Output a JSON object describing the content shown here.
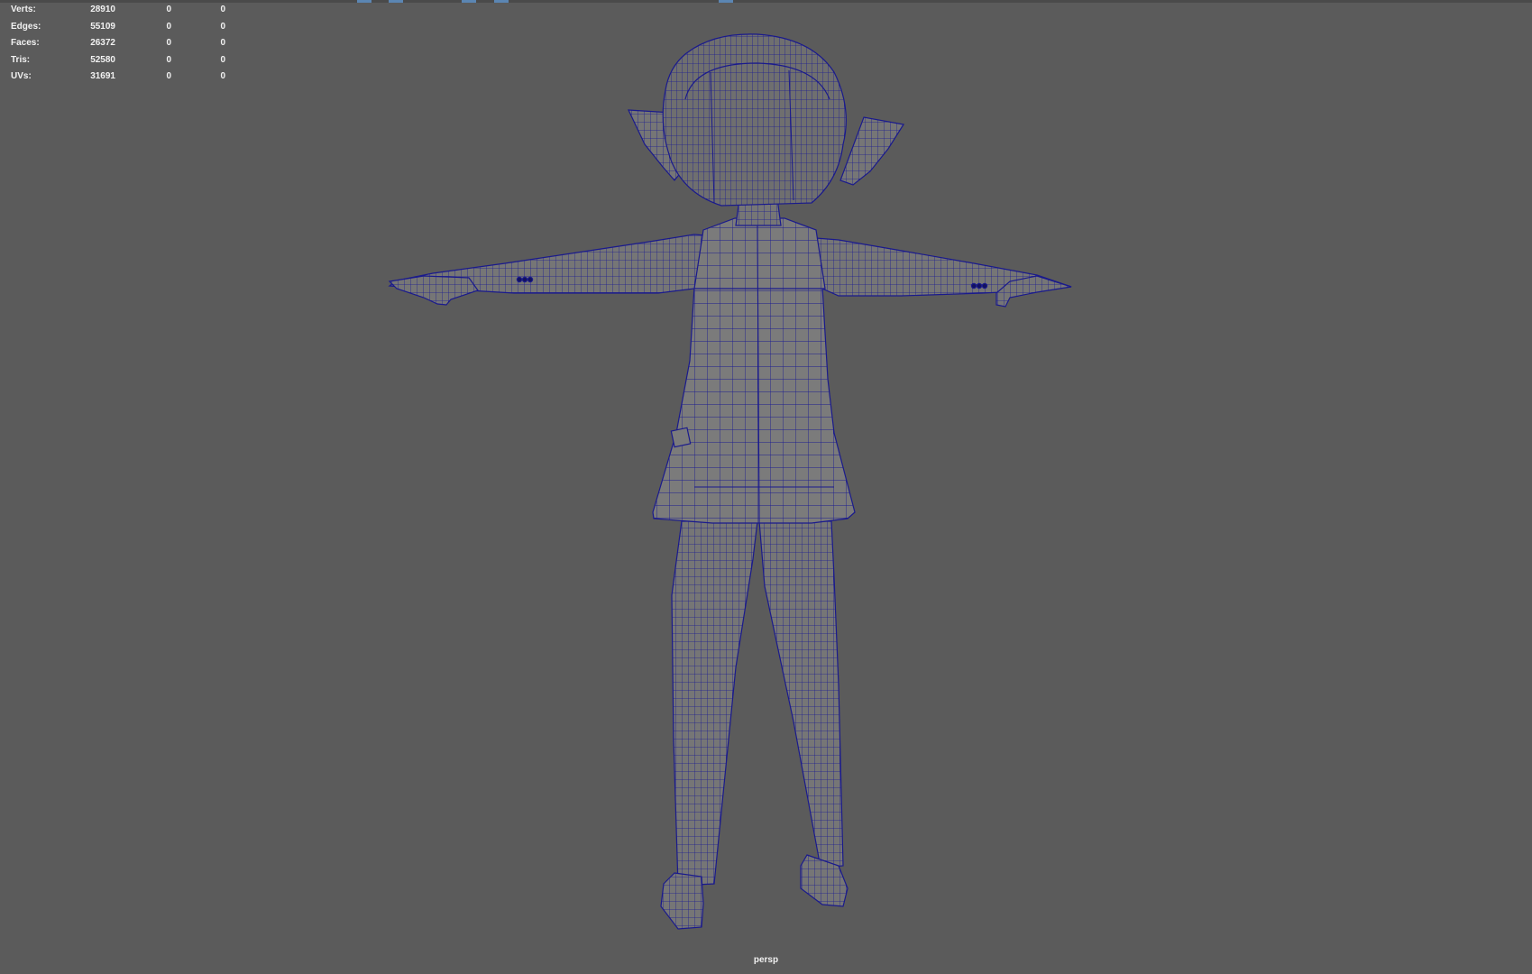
{
  "hud": {
    "rows": [
      {
        "label": "Verts:",
        "total": "28910",
        "selected": "0",
        "component": "0"
      },
      {
        "label": "Edges:",
        "total": "55109",
        "selected": "0",
        "component": "0"
      },
      {
        "label": "Faces:",
        "total": "26372",
        "selected": "0",
        "component": "0"
      },
      {
        "label": "Tris:",
        "total": "52580",
        "selected": "0",
        "component": "0"
      },
      {
        "label": "UVs:",
        "total": "31691",
        "selected": "0",
        "component": "0"
      }
    ]
  },
  "viewport": {
    "camera": "persp",
    "background_color": "#5b5b5b",
    "mesh_fill_color": "#7a7a7a",
    "wireframe_color": "#1a1a8c"
  }
}
